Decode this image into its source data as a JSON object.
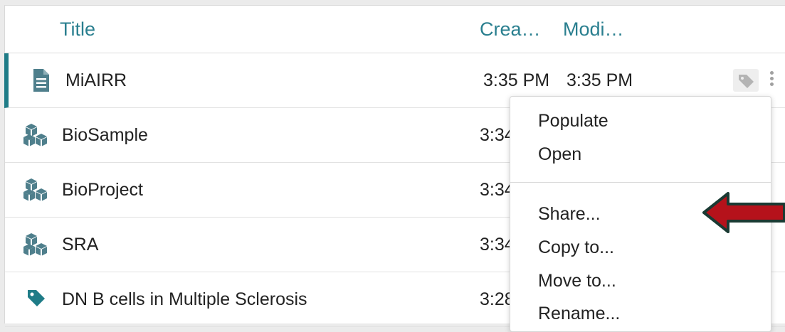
{
  "header": {
    "title_col": "Title",
    "created_col": "Crea…",
    "modified_col": "Modi…"
  },
  "rows": [
    {
      "title": "MiAIRR",
      "created": "3:35 PM",
      "modified": "3:35 PM",
      "icon": "document-icon"
    },
    {
      "title": "BioSample",
      "created": "3:34",
      "modified": "",
      "icon": "cubes-icon"
    },
    {
      "title": "BioProject",
      "created": "3:34",
      "modified": "",
      "icon": "cubes-icon"
    },
    {
      "title": "SRA",
      "created": "3:34",
      "modified": "",
      "icon": "cubes-icon"
    },
    {
      "title": "DN B cells in Multiple Sclerosis",
      "created": "3:28",
      "modified": "",
      "icon": "tag-icon"
    }
  ],
  "context_menu": {
    "items": [
      "Populate",
      "Open",
      "Share...",
      "Copy to...",
      "Move to...",
      "Rename..."
    ]
  },
  "colors": {
    "accent": "#1f7c87",
    "header_text": "#2a7f8f",
    "icon": "#4f7f8c",
    "arrow_fill": "#b5121b",
    "arrow_stroke": "#1a3a33"
  }
}
